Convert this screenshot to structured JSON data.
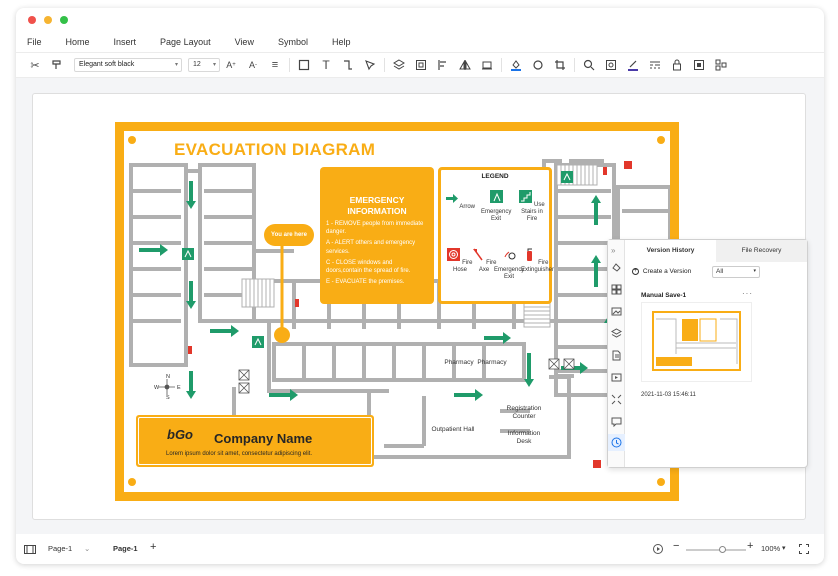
{
  "menu": [
    "File",
    "Home",
    "Insert",
    "Page Layout",
    "View",
    "Symbol",
    "Help"
  ],
  "toolbar": {
    "font": "Elegant soft black",
    "size": "12"
  },
  "diagram": {
    "title": "EVACUATION DIAGRAM",
    "emergency": {
      "heading": "EMERGENCY INFORMATION",
      "lines": [
        "1 - REMOVE people from immediate danger.",
        "A - ALERT others and emergency services.",
        "C - CLOSE windows and doors,contain the spread of fire.",
        "E - EVACUATE the premises."
      ]
    },
    "legend": {
      "title": "LEGEND",
      "items": [
        "Arrow",
        "Emergency Exit",
        "Use Stairs in Fire",
        "Fire Hose",
        "Fire Axe",
        "Emergency Exit",
        "Fire Extinguisher"
      ]
    },
    "you_are_here": "You are here",
    "company_name": "Company Name",
    "company_tagline": "Lorem ipsum dolor sit amet, consectetur adipiscing elit.",
    "logo": "bGo",
    "rooms": [
      "Pharmacy",
      "Pharmacy",
      "Registration Counter",
      "Outpatient Hall",
      "Information Desk"
    ],
    "compass": [
      "N",
      "W",
      "E",
      "S"
    ]
  },
  "version_panel": {
    "tabs": [
      "Version History",
      "File Recovery"
    ],
    "create": "Create a Version",
    "filter": "All",
    "entry_name": "Manual Save-1",
    "entry_date": "2021-11-03 15:46:11"
  },
  "status": {
    "page_selector": "Page-1",
    "page_tab": "Page-1",
    "add": "+",
    "zoom": "100%"
  }
}
